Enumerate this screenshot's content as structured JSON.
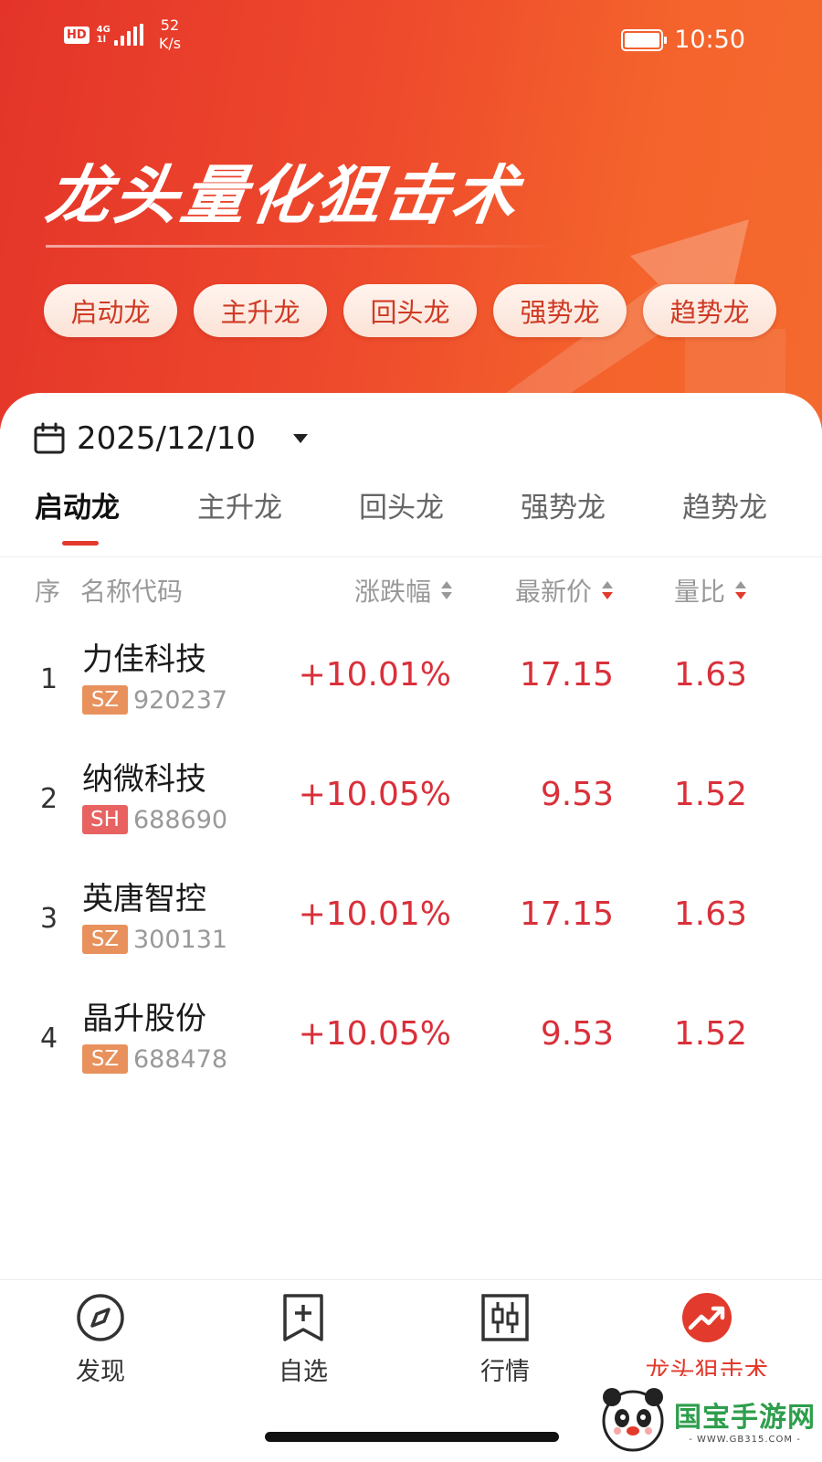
{
  "status_bar": {
    "hd": "HD",
    "network": "4G",
    "speed_value": "52",
    "speed_unit": "K/s",
    "time": "10:50"
  },
  "hero": {
    "title": "龙头量化狙击术",
    "chips": [
      "启动龙",
      "主升龙",
      "回头龙",
      "强势龙",
      "趋势龙"
    ]
  },
  "date_selector": {
    "date": "2025/12/10",
    "icon": "calendar-icon"
  },
  "tabs": [
    {
      "label": "启动龙",
      "active": true
    },
    {
      "label": "主升龙",
      "active": false
    },
    {
      "label": "回头龙",
      "active": false
    },
    {
      "label": "强势龙",
      "active": false
    },
    {
      "label": "趋势龙",
      "active": false
    }
  ],
  "table": {
    "headers": {
      "index": "序",
      "name_code": "名称代码",
      "change": "涨跌幅",
      "price": "最新价",
      "volume_ratio": "量比"
    },
    "rows": [
      {
        "index": "1",
        "name": "力佳科技",
        "market": "SZ",
        "code": "920237",
        "change": "+10.01%",
        "price": "17.15",
        "volume_ratio": "1.63"
      },
      {
        "index": "2",
        "name": "纳微科技",
        "market": "SH",
        "code": "688690",
        "change": "+10.05%",
        "price": "9.53",
        "volume_ratio": "1.52"
      },
      {
        "index": "3",
        "name": "英唐智控",
        "market": "SZ",
        "code": "300131",
        "change": "+10.01%",
        "price": "17.15",
        "volume_ratio": "1.63"
      },
      {
        "index": "4",
        "name": "晶升股份",
        "market": "SZ",
        "code": "688478",
        "change": "+10.05%",
        "price": "9.53",
        "volume_ratio": "1.52"
      }
    ]
  },
  "bottom_nav": [
    {
      "label": "发现",
      "icon": "compass-icon",
      "active": false
    },
    {
      "label": "自选",
      "icon": "bookmark-plus-icon",
      "active": false
    },
    {
      "label": "行情",
      "icon": "candlestick-icon",
      "active": false
    },
    {
      "label": "龙头狙击术",
      "icon": "trend-up-icon",
      "active": true
    }
  ],
  "watermark": {
    "brand": "国宝手游网",
    "url": "- WWW.GB315.COM -"
  },
  "colors": {
    "brand_red": "#e23a2c",
    "up_red": "#d9303a",
    "sz_badge": "#e8915c",
    "sh_badge": "#e86262"
  }
}
